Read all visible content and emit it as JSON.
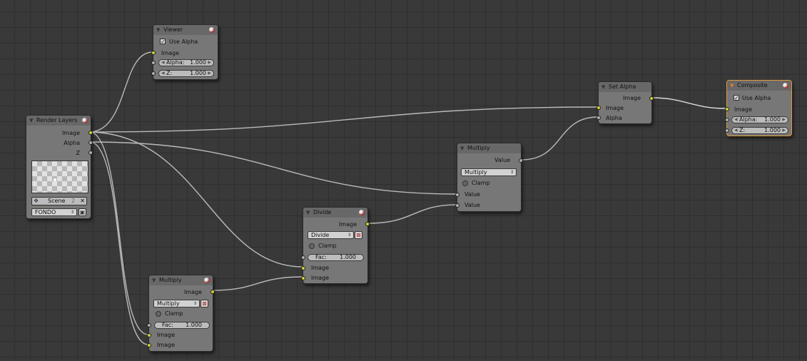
{
  "colors": {
    "grid_bg": "#393939",
    "node_body": "#777777",
    "header": "#686868",
    "socket_color": "#cfcf34",
    "socket_value": "#b0b0b0",
    "link": "#c8c8c8",
    "active_border": "#e39a3a"
  },
  "viewer": {
    "title": "Viewer",
    "use_alpha": "Use Alpha",
    "image": "Image",
    "alpha_label": "Alpha:",
    "alpha_value": "1.000",
    "z_label": "Z:",
    "z_value": "1.000"
  },
  "render_layers": {
    "title": "Render Layers",
    "out_image": "Image",
    "out_alpha": "Alpha",
    "out_z": "Z",
    "scene": "Scene",
    "scene_num": "2",
    "layer": "FONDO"
  },
  "set_alpha": {
    "title": "Set Alpha",
    "out_image": "Image",
    "in_image": "Image",
    "in_alpha": "Alpha"
  },
  "composite": {
    "title": "Composite",
    "use_alpha": "Use Alpha",
    "image": "Image",
    "alpha_label": "Alpha:",
    "alpha_value": "1.000",
    "z_label": "Z:",
    "z_value": "1.000"
  },
  "multiply_value": {
    "title": "Multiply",
    "out_value": "Value",
    "operation": "Multiply",
    "clamp": "Clamp",
    "in_value1": "Value",
    "in_value2": "Value"
  },
  "divide": {
    "title": "Divide",
    "out_image": "Image",
    "operation": "Divide",
    "clamp": "Clamp",
    "fac_label": "Fac:",
    "fac_value": "1.000",
    "in_image1": "Image",
    "in_image2": "Image"
  },
  "multiply_color": {
    "title": "Multiply",
    "out_image": "Image",
    "operation": "Multiply",
    "clamp": "Clamp",
    "fac_label": "Fac:",
    "fac_value": "1.000",
    "in_image1": "Image",
    "in_image2": "Image"
  }
}
